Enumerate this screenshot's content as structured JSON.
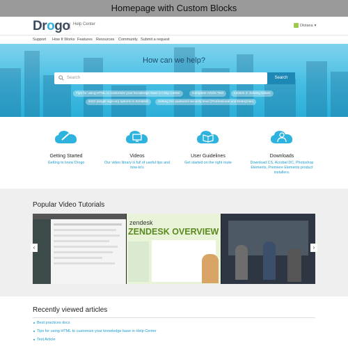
{
  "caption": "Homepage with Custom Blocks",
  "header": {
    "logo_prefix": "Dr",
    "logo_o": "o",
    "logo_suffix": "go",
    "logo_sub": "Help Center",
    "user_name": "Diolana",
    "user_caret": "▾"
  },
  "nav": [
    "Support",
    "How It Works",
    "Features",
    "Resources",
    "Community",
    "Submit a request"
  ],
  "hero": {
    "title": "How can we help?",
    "search_placeholder": "Search",
    "search_button": "Search",
    "pills": [
      "Tips for using HTML to customize your knowledge base in Help Center",
      "Complete Article Test",
      "Lesson 3: Solving tickets",
      "SSO (single sign-on) options in Zendesk",
      "Setting the password security level (Professional and Enterprise)"
    ]
  },
  "features": [
    {
      "title": "Getting Started",
      "desc": "Getting to know Drogo",
      "icon": "pencil-cloud-icon"
    },
    {
      "title": "Videos",
      "desc": "Our video library is full of useful tips and how-to's",
      "icon": "monitor-cloud-icon"
    },
    {
      "title": "User Guidelines",
      "desc": "Get started on the right route",
      "icon": "book-cloud-icon"
    },
    {
      "title": "Downloads",
      "desc": "Download CS, Acrobat DC, Photoshop Elements, Premiere Elements product installers.",
      "icon": "person-cloud-icon"
    }
  ],
  "videos": {
    "title": "Popular Video Tutorials",
    "slide2_brand": "zendesk",
    "slide2_heading": "ZENDESK OVERVIEW",
    "prev": "‹",
    "next": "›"
  },
  "recent": {
    "title": "Recently viewed articles",
    "items": [
      "Best practices docs",
      "Tips for using HTML to customize your knowledge base in Help Center",
      "Test Article"
    ]
  },
  "colors": {
    "accent": "#1a9bcc",
    "hero": "#45bde3",
    "brand": "#3b4a5c"
  }
}
